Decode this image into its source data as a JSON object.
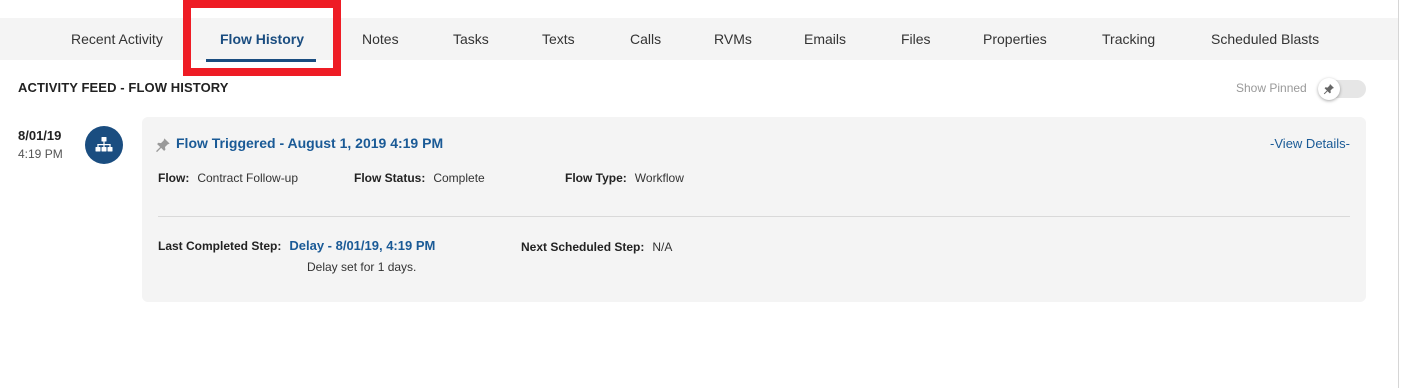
{
  "tabs": [
    {
      "label": "Recent Activity",
      "active": false
    },
    {
      "label": "Flow History",
      "active": true
    },
    {
      "label": "Notes",
      "active": false
    },
    {
      "label": "Tasks",
      "active": false
    },
    {
      "label": "Texts",
      "active": false
    },
    {
      "label": "Calls",
      "active": false
    },
    {
      "label": "RVMs",
      "active": false
    },
    {
      "label": "Emails",
      "active": false
    },
    {
      "label": "Files",
      "active": false
    },
    {
      "label": "Properties",
      "active": false
    },
    {
      "label": "Tracking",
      "active": false
    },
    {
      "label": "Scheduled Blasts",
      "active": false
    }
  ],
  "feed": {
    "title": "ACTIVITY FEED - FLOW HISTORY",
    "show_pinned_label": "Show Pinned",
    "show_pinned_on": false
  },
  "entry": {
    "date": "8/01/19",
    "time": "4:19 PM",
    "icon": "flow-hierarchy-icon",
    "title": "Flow Triggered - August 1, 2019 4:19 PM",
    "view_details": "-View Details-",
    "flow_label": "Flow:",
    "flow_value": "Contract Follow-up",
    "status_label": "Flow Status:",
    "status_value": "Complete",
    "type_label": "Flow Type:",
    "type_value": "Workflow",
    "last_step_label": "Last Completed Step:",
    "last_step_value": "Delay - 8/01/19, 4:19 PM",
    "last_step_note": "Delay set for 1 days.",
    "next_step_label": "Next Scheduled Step:",
    "next_step_value": "N/A"
  },
  "colors": {
    "accent": "#1a4d80",
    "link": "#1a5a96",
    "highlight": "#ee1c25",
    "card_bg": "#f4f4f4"
  }
}
